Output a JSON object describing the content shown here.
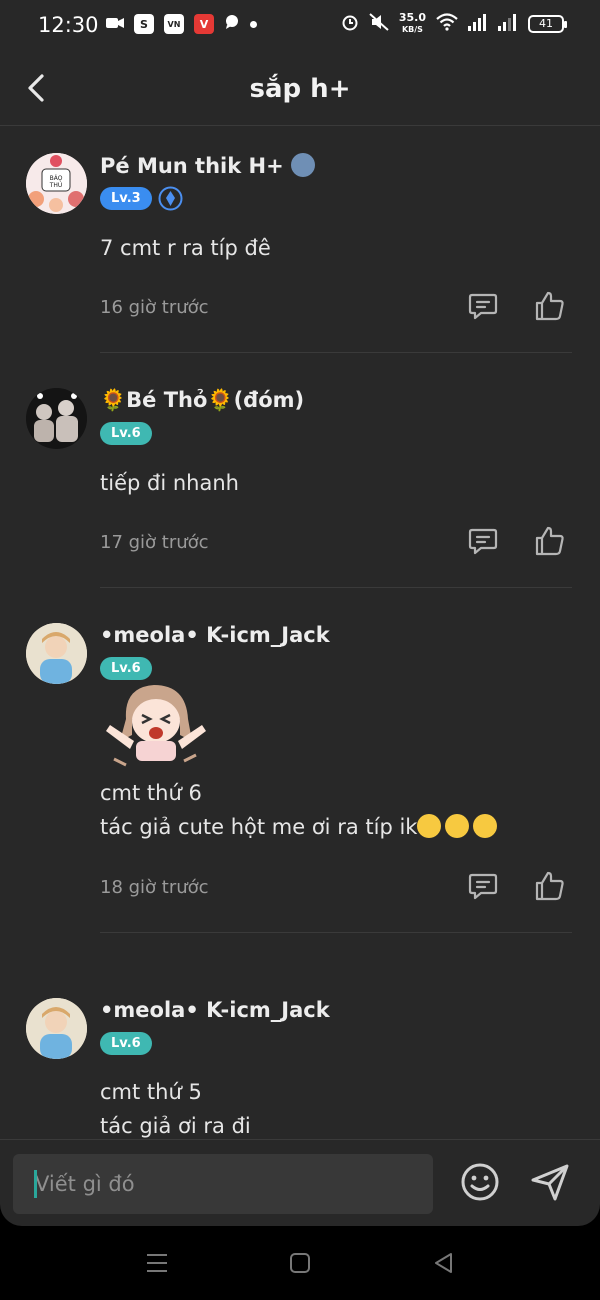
{
  "status_bar": {
    "time": "12:30",
    "net_speed_value": "35.0",
    "net_speed_unit": "KB/S",
    "battery": "41"
  },
  "header": {
    "title": "sắp h+",
    "back_icon": "chevron-left-icon"
  },
  "comments": [
    {
      "username": "Pé Mun thik H+",
      "level": "Lv.3",
      "text_lines": [
        "7 cmt r ra típ đê"
      ],
      "time": "16 giờ trước",
      "avatar_label": "BÁO THỦ"
    },
    {
      "username_prefix": "🌻",
      "username_main": "Bé Thỏ",
      "username_suffix": "🌻(đóm)",
      "level": "Lv.6",
      "text_lines": [
        "tiếp đi nhanh"
      ],
      "time": "17 giờ trước"
    },
    {
      "username": "•meola• K-icm_Jack",
      "level": "Lv.6",
      "text_lines": [
        "cmt thứ 6",
        "tác giả cute hột me ơi ra típ ik"
      ],
      "time": "18 giờ trước",
      "has_sticker": true
    },
    {
      "username": "•meola• K-icm_Jack",
      "level": "Lv.6",
      "text_lines": [
        "cmt thứ 5",
        "tác giả ơi ra đi"
      ],
      "time": ""
    }
  ],
  "input": {
    "placeholder": "Viết gì đó"
  },
  "colors": {
    "background": "#282828",
    "badge_blue": "#3a8df0",
    "badge_teal": "#3fb8b2",
    "divider": "#3a3a3a",
    "cursor": "#2aa79b"
  }
}
